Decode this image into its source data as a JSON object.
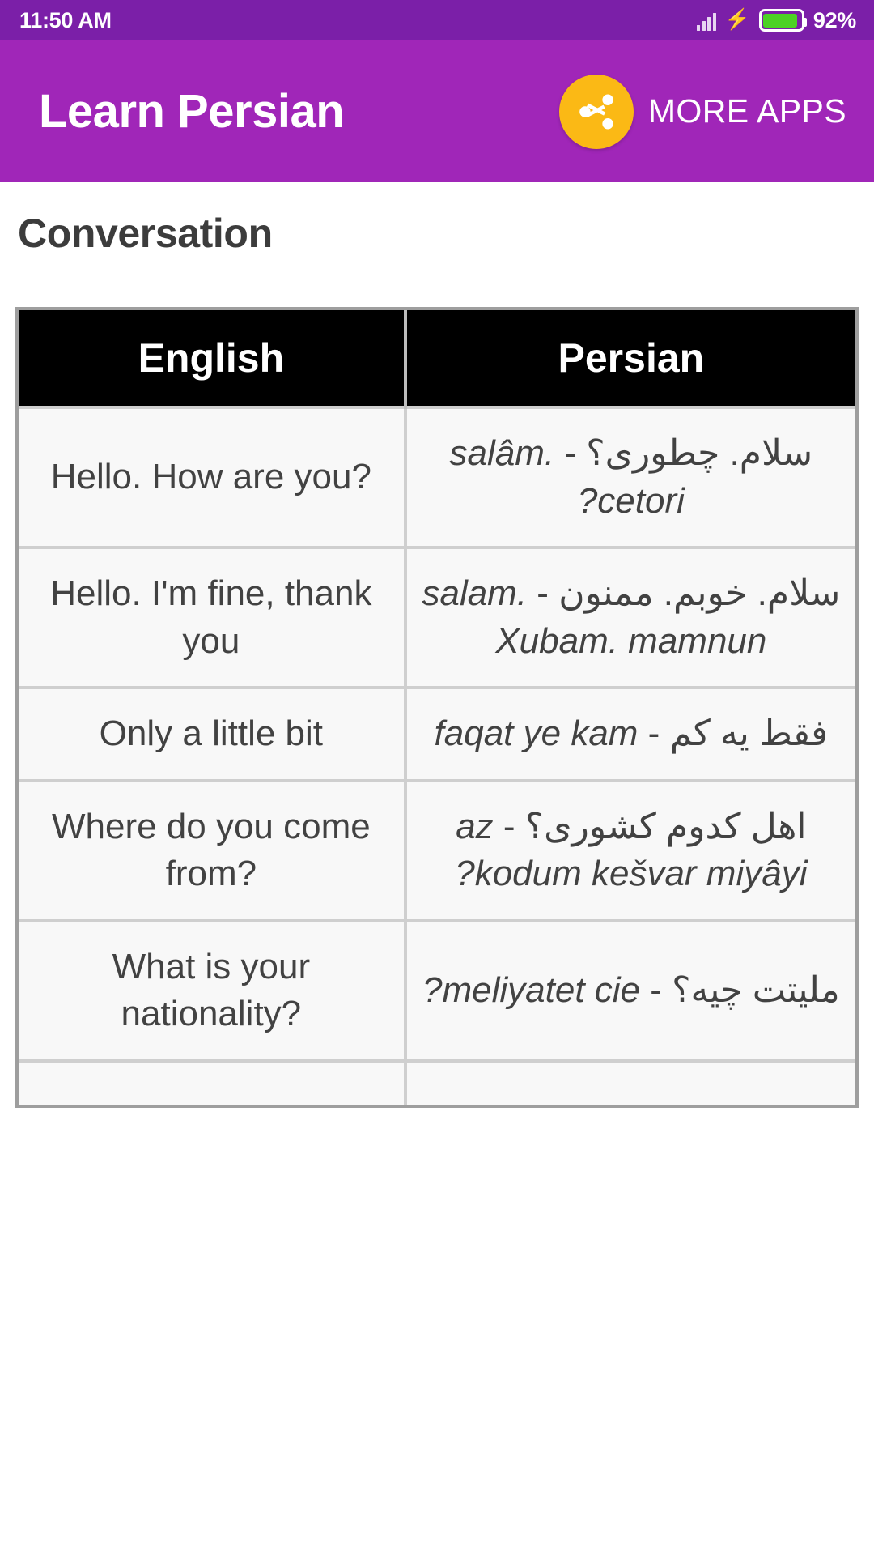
{
  "status_bar": {
    "time": "11:50 AM",
    "battery_percent": "92%",
    "icons": [
      "signal-bars-icon",
      "charging-bolt-icon",
      "battery-icon"
    ],
    "background_color": "#7B1FA8",
    "battery_fill_color": "#4CD225"
  },
  "app_bar": {
    "title": "Learn Persian",
    "share_icon": "share-icon",
    "more_apps_label": "MORE APPS",
    "background_color": "#A026B8",
    "share_button_color": "#FBB915"
  },
  "page": {
    "title": "Conversation",
    "title_color": "#3c3c3c"
  },
  "table": {
    "headers": [
      "English",
      "Persian"
    ],
    "header_background": "#000000",
    "cell_background": "#F8F8F8",
    "border_color": "#9e9e9e",
    "rows": [
      {
        "english": "Hello. How are you?",
        "persian_script": "سلام. چطوری؟",
        "persian_translit": "salâm. cetori?"
      },
      {
        "english": "Hello. I'm fine, thank you",
        "persian_script": "سلام. خوبم. ممنون",
        "persian_translit": "salam. Xubam. mamnun"
      },
      {
        "english": "Only a little bit",
        "persian_script": "فقط یه کم",
        "persian_translit": "faqat ye kam"
      },
      {
        "english": "Where do you come from?",
        "persian_script": "اهل کدوم کشوری؟",
        "persian_translit": "az kodum kešvar miyâyi?"
      },
      {
        "english": "What is your nationality?",
        "persian_script": "ملیتت چیه؟",
        "persian_translit": "meliyatet cie?"
      },
      {
        "english": "",
        "persian_script": "",
        "persian_translit": ""
      }
    ]
  }
}
